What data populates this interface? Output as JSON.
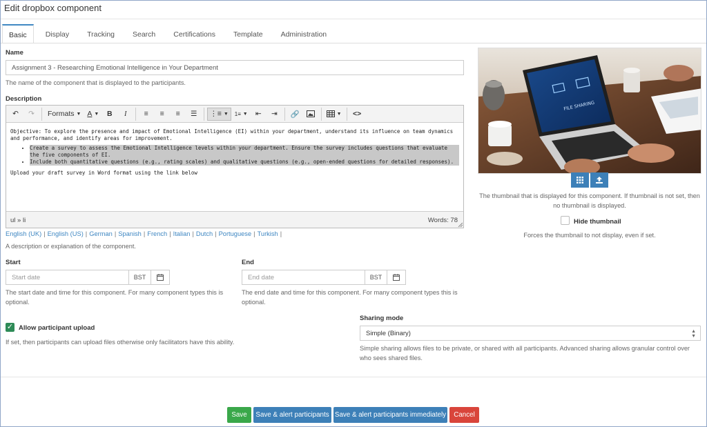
{
  "window": {
    "title": "Edit dropbox component"
  },
  "tabs": [
    "Basic",
    "Display",
    "Tracking",
    "Search",
    "Certifications",
    "Template",
    "Administration"
  ],
  "name": {
    "label": "Name",
    "value": "Assignment 3 - Researching Emotional Intelligence in Your Department",
    "help": "The name of the component that is displayed to the participants."
  },
  "description": {
    "label": "Description",
    "toolbar": {
      "formats": "Formats",
      "font_color": "A",
      "bold": "B",
      "italic": "I",
      "code": "<>"
    },
    "content": {
      "paragraph": "Objective: To explore the presence and impact of Emotional Intelligence (EI) within your department, understand its influence on team dynamics and performance, and identify areas for improvement.",
      "bullets": [
        "Create a survey to assess the Emotional Intelligence levels within your department. Ensure the survey includes questions that evaluate the five components of EI.",
        "Include both quantitative questions (e.g., rating scales) and qualitative questions (e.g., open-ended questions for detailed responses)."
      ],
      "footer": "Upload your draft survey in Word format using the link below"
    },
    "status_path": "ul » li",
    "word_count": "Words: 78",
    "languages": [
      "English (UK)",
      "English (US)",
      "German",
      "Spanish",
      "French",
      "Italian",
      "Dutch",
      "Portuguese",
      "Turkish"
    ],
    "help": "A description or explanation of the component."
  },
  "start": {
    "label": "Start",
    "placeholder": "Start date",
    "timezone": "BST",
    "help": "The start date and time for this component. For many component types this is optional."
  },
  "end": {
    "label": "End",
    "placeholder": "End date",
    "timezone": "BST",
    "help": "The end date and time for this component. For many component types this is optional."
  },
  "upload": {
    "label": "Allow participant upload",
    "checked": true,
    "help": "If set, then participants can upload files otherwise only facilitators have this ability."
  },
  "sharing": {
    "label": "Sharing mode",
    "value": "Simple (Binary)",
    "help": "Simple sharing allows files to be private, or shared with all participants. Advanced sharing allows granular control over who sees shared files."
  },
  "thumbnail": {
    "screen_text": "FILE SHARING",
    "help": "The thumbnail that is displayed for this component. If thumbnail is not set, then no thumbnail is displayed.",
    "hide_label": "Hide thumbnail",
    "hide_checked": false,
    "hide_help": "Forces the thumbnail to not display, even if set."
  },
  "buttons": {
    "save": "Save",
    "save_alert": "Save & alert participants",
    "save_alert_now": "Save & alert participants immediately",
    "cancel": "Cancel"
  },
  "colors": {
    "accent": "#3d80b8",
    "save": "#3aa84a",
    "cancel": "#d9453b",
    "check": "#2e8b57"
  }
}
